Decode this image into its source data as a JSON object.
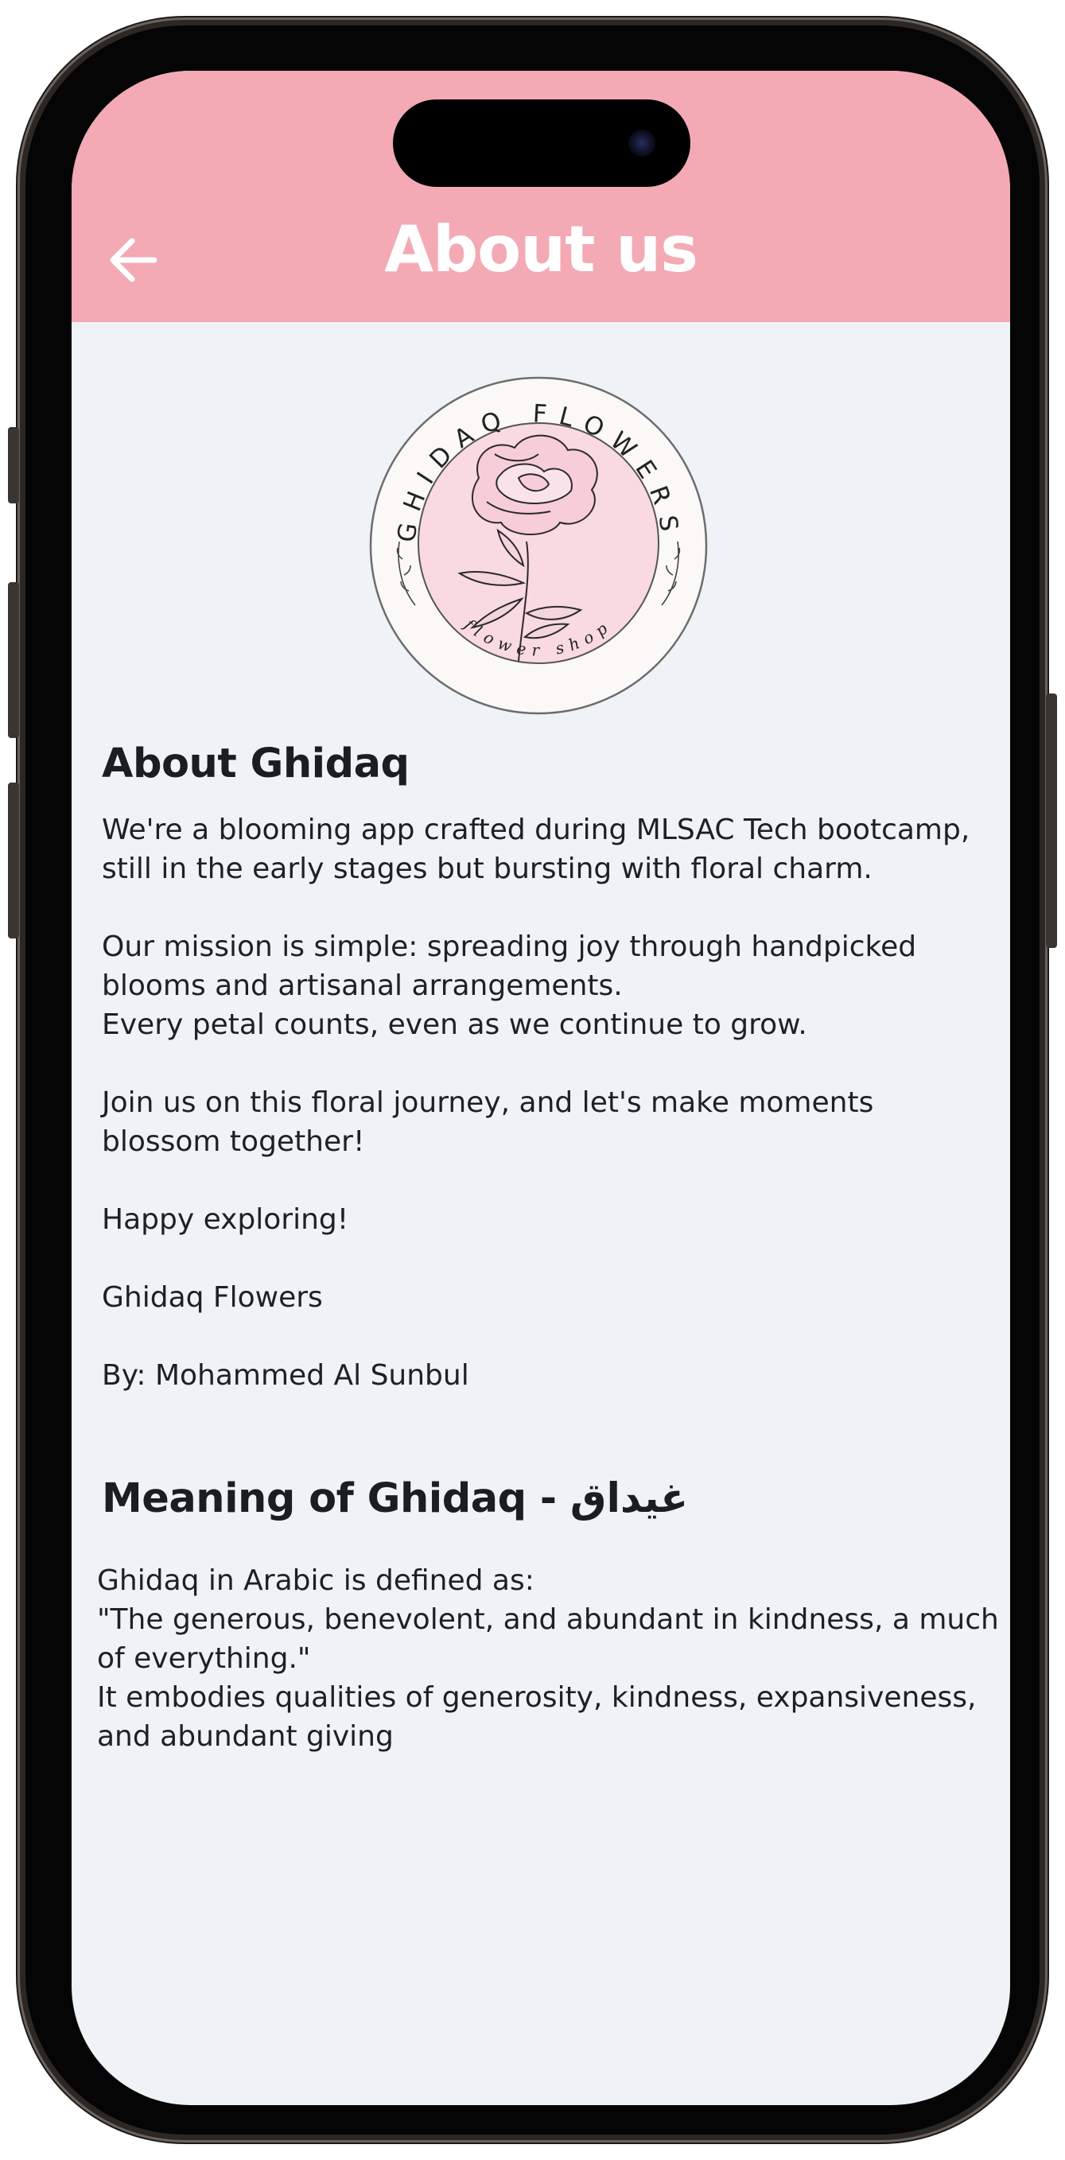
{
  "app_bar": {
    "title": "About us",
    "back_icon": "arrow-left-icon",
    "background": "#f3aab5"
  },
  "logo": {
    "ring_text": "GHIDAQ FLOWERS",
    "bottom_text": "flower shop",
    "icon": "peony-flower-icon",
    "inner_color": "#f9d9e2"
  },
  "about": {
    "heading": "About Ghidaq",
    "lines": [
      "We're a blooming app crafted during MLSAC Tech bootcamp,",
      "still in the early stages but bursting with floral charm.",
      "",
      "Our mission is simple: spreading joy through handpicked",
      "blooms and artisanal arrangements.",
      "Every petal counts, even as we continue to grow.",
      "",
      "Join us on this floral journey, and let's make moments",
      "blossom together!",
      "",
      "Happy exploring!",
      "",
      "Ghidaq Flowers",
      "",
      "By: Mohammed Al Sunbul"
    ]
  },
  "meaning": {
    "heading": "Meaning of Ghidaq - غيداق",
    "lines": [
      "Ghidaq in Arabic is defined as:",
      "\"The generous, benevolent, and abundant in kindness, a much",
      "of everything.\"",
      "It embodies qualities of generosity, kindness, expansiveness,",
      "and abundant giving"
    ]
  },
  "colors": {
    "screen_background": "#eff2f7",
    "text": "#1e2024"
  }
}
